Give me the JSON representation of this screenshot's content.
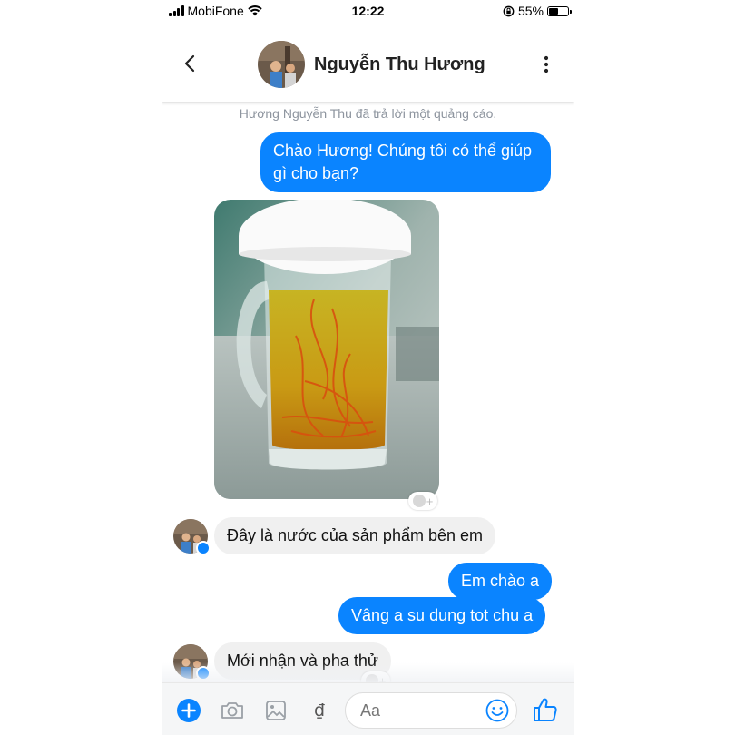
{
  "status": {
    "carrier": "MobiFone",
    "time": "12:22",
    "battery": "55%",
    "battery_level": 0.55
  },
  "header": {
    "contact_name": "Nguyễn Thu Hương",
    "icons": [
      "back-chevron-icon",
      "more-vertical-icon"
    ]
  },
  "conversation": {
    "system_note": "Hương Nguyễn Thu đã trả lời một quảng cáo.",
    "messages": [
      {
        "from": "me",
        "text": "Chào Hương! Chúng tôi có thể giúp gì cho bạn?"
      },
      {
        "from": "contact",
        "type": "photo",
        "description": "glass-mug-of-herbal-tea-icon"
      },
      {
        "from": "contact",
        "text": "Đây là nước của sản phẩm bên em"
      },
      {
        "from": "me",
        "text": "Em chào a"
      },
      {
        "from": "me",
        "text": "Vâng a su dung tot chu a"
      },
      {
        "from": "contact",
        "text": "Mới nhận và pha thử"
      }
    ]
  },
  "composer": {
    "placeholder": "Aa",
    "tools": [
      "plus-icon",
      "camera-icon",
      "gallery-icon",
      "payment-dong-icon"
    ],
    "accent": "#0a84ff"
  }
}
